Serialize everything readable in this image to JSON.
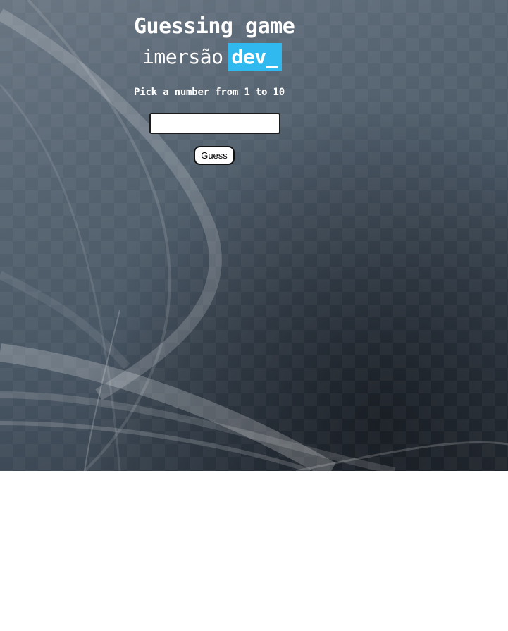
{
  "header": {
    "title": "Guessing game",
    "brand_word": "imersão",
    "brand_tag": "dev_"
  },
  "main": {
    "prompt": "Pick a number from 1 to 10",
    "guess_input": {
      "value": "",
      "placeholder": ""
    },
    "guess_button_label": "Guess"
  },
  "colors": {
    "accent": "#2fb9ef",
    "text": "#ffffff",
    "background_dark": "#3a4552",
    "page_background": "#ffffff"
  }
}
